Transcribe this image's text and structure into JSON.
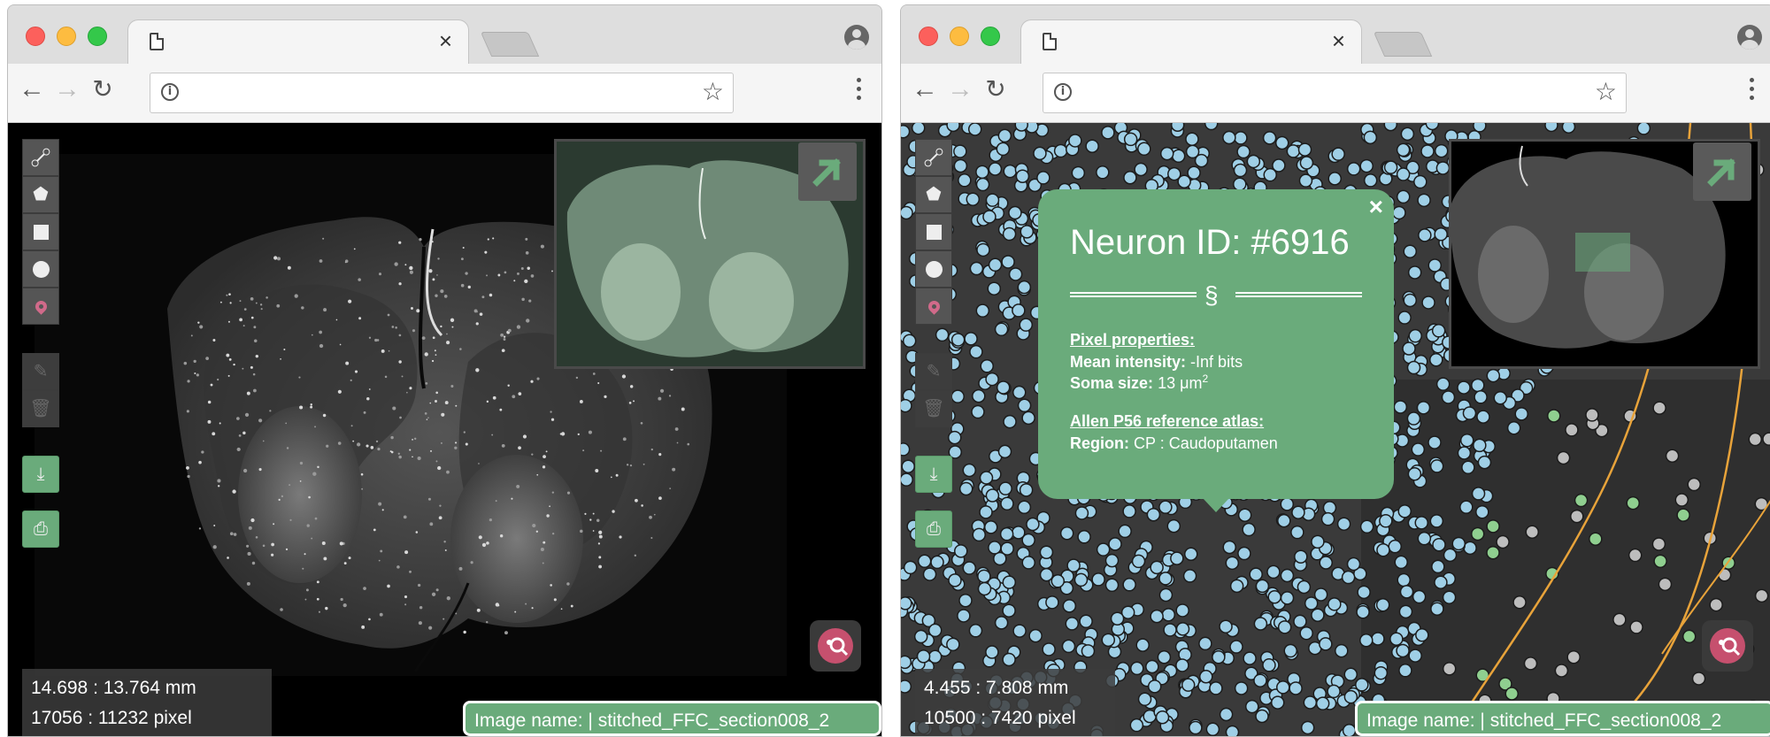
{
  "left": {
    "tab_title": "",
    "coords_mm": "14.698 : 13.764 mm",
    "coords_px": "17056 : 11232 pixel",
    "image_name": "Image name: | stitched_FFC_section008_2"
  },
  "right": {
    "tab_title": "",
    "coords_mm": "4.455 : 7.808 mm",
    "coords_px": "10500 : 7420 pixel",
    "image_name": "Image name: | stitched_FFC_section008_2",
    "popup": {
      "title": "Neuron ID: #6916",
      "divider_symbol": "§",
      "pixel_heading": "Pixel properties:",
      "mean_label": "Mean intensity:",
      "mean_value": "-Inf bits",
      "soma_label": "Soma size:",
      "soma_value": "13 μm",
      "soma_exp": "2",
      "atlas_heading": "Allen P56 reference atlas:",
      "region_label": "Region:",
      "region_value": "CP : Caudoputamen",
      "close": "×"
    }
  },
  "browser": {
    "url": "",
    "tab_close": "×",
    "back": "←",
    "forward": "→",
    "reload": "↻",
    "star": "☆"
  },
  "colors": {
    "green_accent": "#6aab7b",
    "neuron_blue": "#9fcfe6",
    "neuron_gray": "#bdbdbd",
    "neuron_green": "#8fcf8f",
    "region_orange": "#e8a33a",
    "pin_pink": "#d16a8a"
  }
}
